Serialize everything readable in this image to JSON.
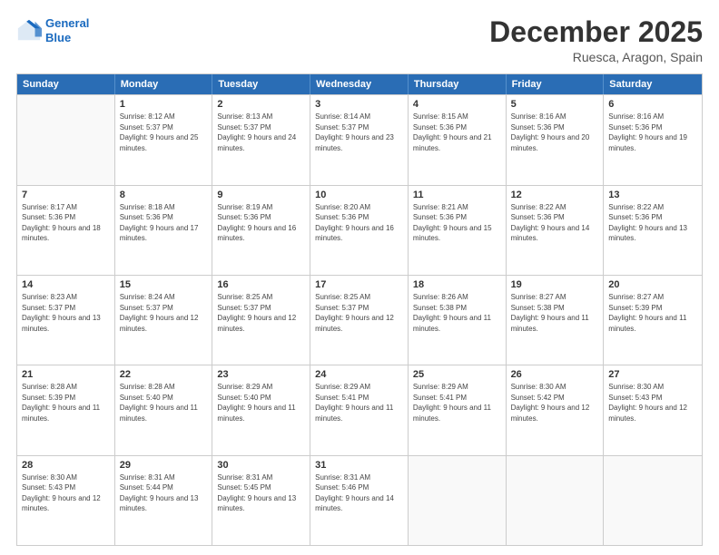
{
  "logo": {
    "line1": "General",
    "line2": "Blue"
  },
  "title": "December 2025",
  "location": "Ruesca, Aragon, Spain",
  "header_days": [
    "Sunday",
    "Monday",
    "Tuesday",
    "Wednesday",
    "Thursday",
    "Friday",
    "Saturday"
  ],
  "weeks": [
    [
      {
        "day": "",
        "empty": true
      },
      {
        "day": "1",
        "sunrise": "Sunrise: 8:12 AM",
        "sunset": "Sunset: 5:37 PM",
        "daylight": "Daylight: 9 hours and 25 minutes."
      },
      {
        "day": "2",
        "sunrise": "Sunrise: 8:13 AM",
        "sunset": "Sunset: 5:37 PM",
        "daylight": "Daylight: 9 hours and 24 minutes."
      },
      {
        "day": "3",
        "sunrise": "Sunrise: 8:14 AM",
        "sunset": "Sunset: 5:37 PM",
        "daylight": "Daylight: 9 hours and 23 minutes."
      },
      {
        "day": "4",
        "sunrise": "Sunrise: 8:15 AM",
        "sunset": "Sunset: 5:36 PM",
        "daylight": "Daylight: 9 hours and 21 minutes."
      },
      {
        "day": "5",
        "sunrise": "Sunrise: 8:16 AM",
        "sunset": "Sunset: 5:36 PM",
        "daylight": "Daylight: 9 hours and 20 minutes."
      },
      {
        "day": "6",
        "sunrise": "Sunrise: 8:16 AM",
        "sunset": "Sunset: 5:36 PM",
        "daylight": "Daylight: 9 hours and 19 minutes."
      }
    ],
    [
      {
        "day": "7",
        "sunrise": "Sunrise: 8:17 AM",
        "sunset": "Sunset: 5:36 PM",
        "daylight": "Daylight: 9 hours and 18 minutes."
      },
      {
        "day": "8",
        "sunrise": "Sunrise: 8:18 AM",
        "sunset": "Sunset: 5:36 PM",
        "daylight": "Daylight: 9 hours and 17 minutes."
      },
      {
        "day": "9",
        "sunrise": "Sunrise: 8:19 AM",
        "sunset": "Sunset: 5:36 PM",
        "daylight": "Daylight: 9 hours and 16 minutes."
      },
      {
        "day": "10",
        "sunrise": "Sunrise: 8:20 AM",
        "sunset": "Sunset: 5:36 PM",
        "daylight": "Daylight: 9 hours and 16 minutes."
      },
      {
        "day": "11",
        "sunrise": "Sunrise: 8:21 AM",
        "sunset": "Sunset: 5:36 PM",
        "daylight": "Daylight: 9 hours and 15 minutes."
      },
      {
        "day": "12",
        "sunrise": "Sunrise: 8:22 AM",
        "sunset": "Sunset: 5:36 PM",
        "daylight": "Daylight: 9 hours and 14 minutes."
      },
      {
        "day": "13",
        "sunrise": "Sunrise: 8:22 AM",
        "sunset": "Sunset: 5:36 PM",
        "daylight": "Daylight: 9 hours and 13 minutes."
      }
    ],
    [
      {
        "day": "14",
        "sunrise": "Sunrise: 8:23 AM",
        "sunset": "Sunset: 5:37 PM",
        "daylight": "Daylight: 9 hours and 13 minutes."
      },
      {
        "day": "15",
        "sunrise": "Sunrise: 8:24 AM",
        "sunset": "Sunset: 5:37 PM",
        "daylight": "Daylight: 9 hours and 12 minutes."
      },
      {
        "day": "16",
        "sunrise": "Sunrise: 8:25 AM",
        "sunset": "Sunset: 5:37 PM",
        "daylight": "Daylight: 9 hours and 12 minutes."
      },
      {
        "day": "17",
        "sunrise": "Sunrise: 8:25 AM",
        "sunset": "Sunset: 5:37 PM",
        "daylight": "Daylight: 9 hours and 12 minutes."
      },
      {
        "day": "18",
        "sunrise": "Sunrise: 8:26 AM",
        "sunset": "Sunset: 5:38 PM",
        "daylight": "Daylight: 9 hours and 11 minutes."
      },
      {
        "day": "19",
        "sunrise": "Sunrise: 8:27 AM",
        "sunset": "Sunset: 5:38 PM",
        "daylight": "Daylight: 9 hours and 11 minutes."
      },
      {
        "day": "20",
        "sunrise": "Sunrise: 8:27 AM",
        "sunset": "Sunset: 5:39 PM",
        "daylight": "Daylight: 9 hours and 11 minutes."
      }
    ],
    [
      {
        "day": "21",
        "sunrise": "Sunrise: 8:28 AM",
        "sunset": "Sunset: 5:39 PM",
        "daylight": "Daylight: 9 hours and 11 minutes."
      },
      {
        "day": "22",
        "sunrise": "Sunrise: 8:28 AM",
        "sunset": "Sunset: 5:40 PM",
        "daylight": "Daylight: 9 hours and 11 minutes."
      },
      {
        "day": "23",
        "sunrise": "Sunrise: 8:29 AM",
        "sunset": "Sunset: 5:40 PM",
        "daylight": "Daylight: 9 hours and 11 minutes."
      },
      {
        "day": "24",
        "sunrise": "Sunrise: 8:29 AM",
        "sunset": "Sunset: 5:41 PM",
        "daylight": "Daylight: 9 hours and 11 minutes."
      },
      {
        "day": "25",
        "sunrise": "Sunrise: 8:29 AM",
        "sunset": "Sunset: 5:41 PM",
        "daylight": "Daylight: 9 hours and 11 minutes."
      },
      {
        "day": "26",
        "sunrise": "Sunrise: 8:30 AM",
        "sunset": "Sunset: 5:42 PM",
        "daylight": "Daylight: 9 hours and 12 minutes."
      },
      {
        "day": "27",
        "sunrise": "Sunrise: 8:30 AM",
        "sunset": "Sunset: 5:43 PM",
        "daylight": "Daylight: 9 hours and 12 minutes."
      }
    ],
    [
      {
        "day": "28",
        "sunrise": "Sunrise: 8:30 AM",
        "sunset": "Sunset: 5:43 PM",
        "daylight": "Daylight: 9 hours and 12 minutes."
      },
      {
        "day": "29",
        "sunrise": "Sunrise: 8:31 AM",
        "sunset": "Sunset: 5:44 PM",
        "daylight": "Daylight: 9 hours and 13 minutes."
      },
      {
        "day": "30",
        "sunrise": "Sunrise: 8:31 AM",
        "sunset": "Sunset: 5:45 PM",
        "daylight": "Daylight: 9 hours and 13 minutes."
      },
      {
        "day": "31",
        "sunrise": "Sunrise: 8:31 AM",
        "sunset": "Sunset: 5:46 PM",
        "daylight": "Daylight: 9 hours and 14 minutes."
      },
      {
        "day": "",
        "empty": true
      },
      {
        "day": "",
        "empty": true
      },
      {
        "day": "",
        "empty": true
      }
    ]
  ]
}
